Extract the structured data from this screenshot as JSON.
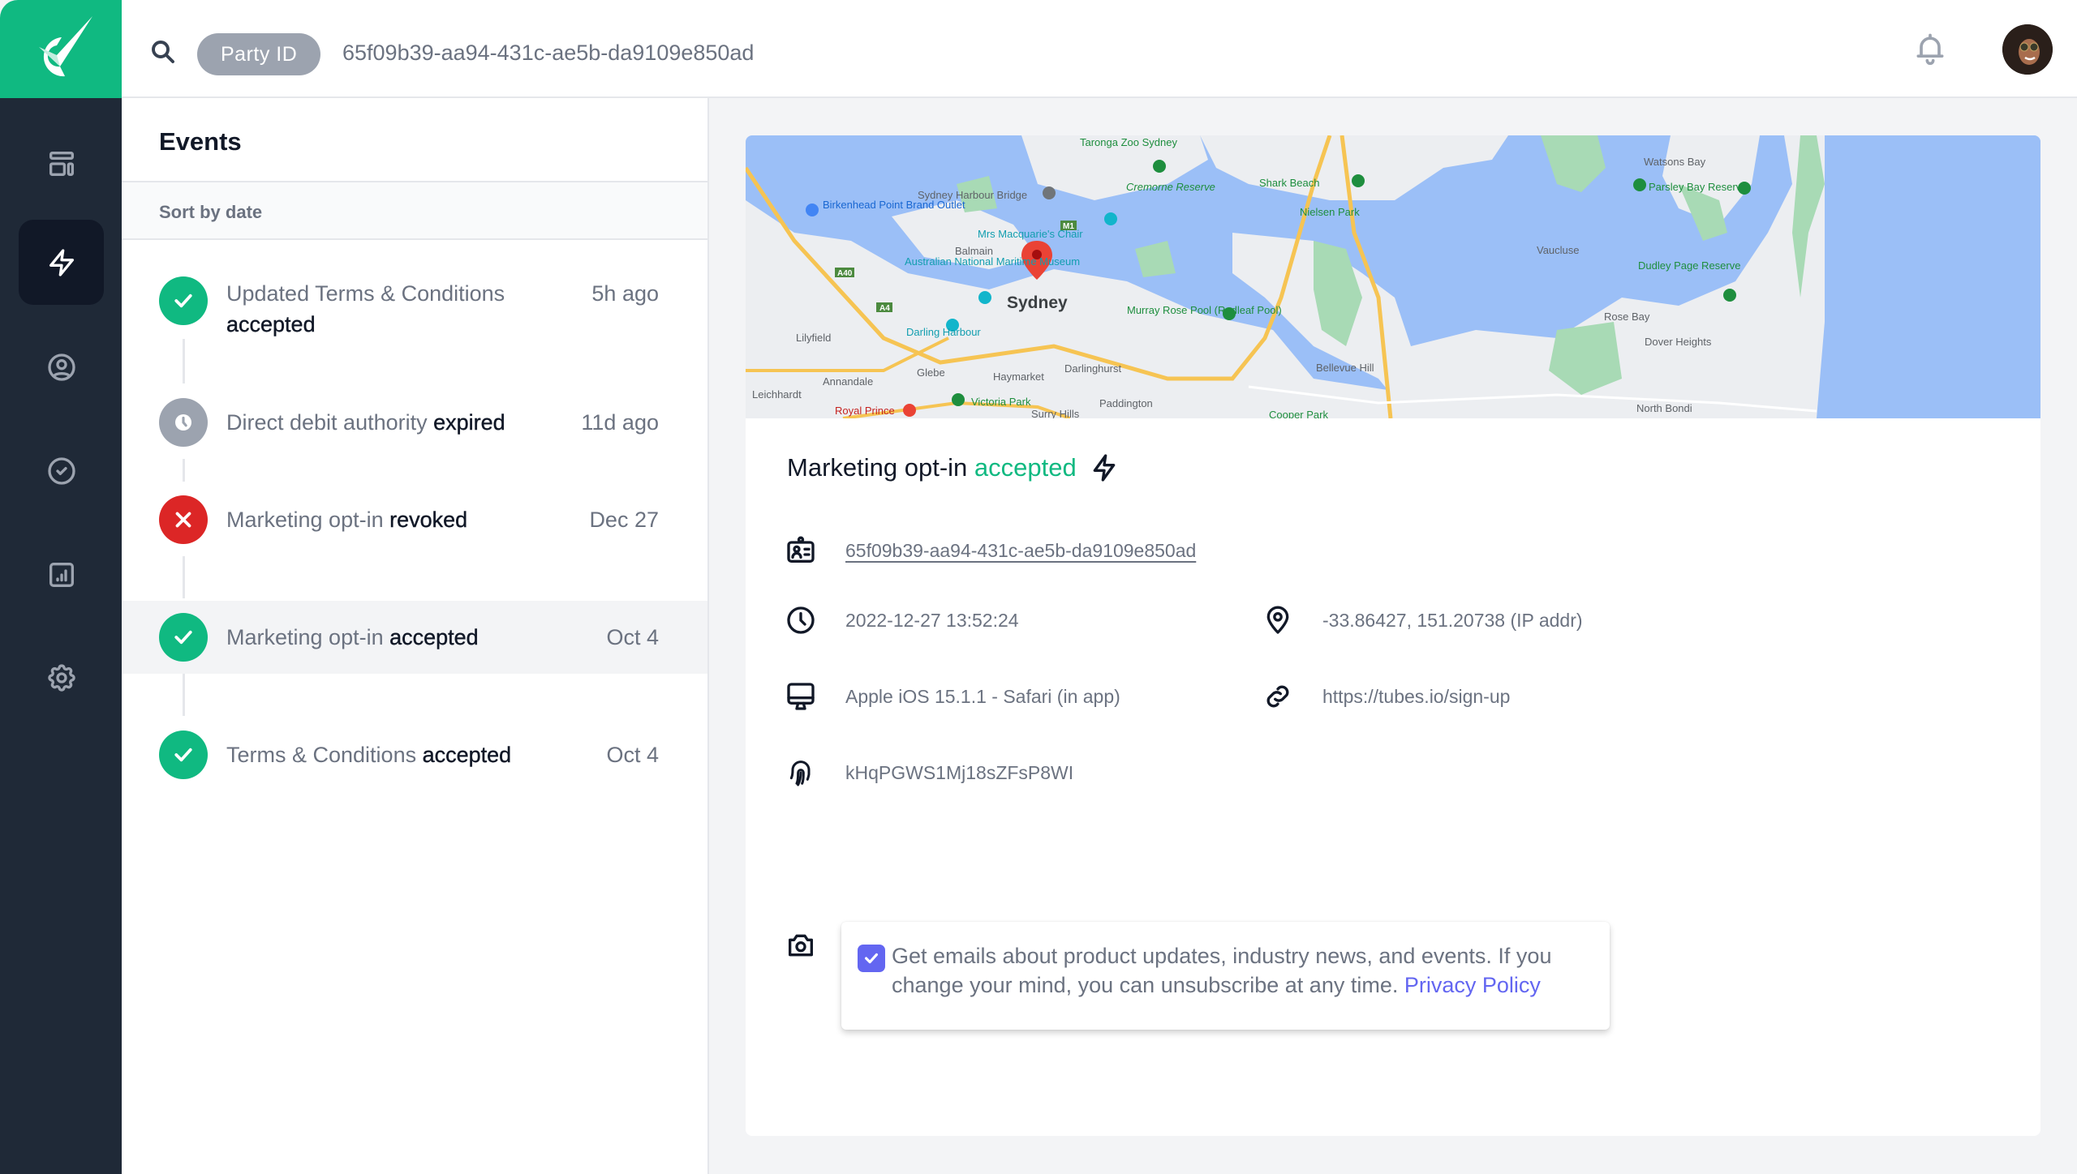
{
  "header": {
    "search_filter_label": "Party ID",
    "search_value": "65f09b39-aa94-431c-ae5b-da9109e850ad"
  },
  "sidebar": {
    "items": [
      {
        "name": "dashboard",
        "icon": "layout-icon",
        "active": false
      },
      {
        "name": "events",
        "icon": "lightning-icon",
        "active": true
      },
      {
        "name": "profile",
        "icon": "user-circle-icon",
        "active": false
      },
      {
        "name": "consents",
        "icon": "check-circle-icon",
        "active": false
      },
      {
        "name": "reports",
        "icon": "chart-icon",
        "active": false
      },
      {
        "name": "settings",
        "icon": "gear-icon",
        "active": false
      }
    ]
  },
  "events": {
    "title": "Events",
    "sort_label": "Sort by date",
    "items": [
      {
        "prefix": "Updated Terms & Conditions",
        "status": "accepted",
        "time": "5h ago",
        "type": "success",
        "icon": "check-icon"
      },
      {
        "prefix": "Direct debit authority",
        "status": "expired",
        "time": "11d ago",
        "type": "expired",
        "icon": "clock-icon"
      },
      {
        "prefix": "Marketing opt-in",
        "status": "revoked",
        "time": "Dec 27",
        "type": "error",
        "icon": "x-icon"
      },
      {
        "prefix": "Marketing opt-in",
        "status": "accepted",
        "time": "Oct 4",
        "type": "success",
        "icon": "check-icon",
        "selected": true
      },
      {
        "prefix": "Terms & Conditions",
        "status": "accepted",
        "time": "Oct 4",
        "type": "success",
        "icon": "check-icon"
      }
    ]
  },
  "detail": {
    "title_prefix": "Marketing opt-in",
    "title_status": "accepted",
    "party_id": "65f09b39-aa94-431c-ae5b-da9109e850ad",
    "timestamp": "2022-12-27 13:52:24",
    "location": "-33.86427, 151.20738 (IP addr)",
    "device": "Apple iOS 15.1.1 - Safari (in app)",
    "url": "https://tubes.io/sign-up",
    "fingerprint": "kHqPGWS1Mj18sZFsP8WI",
    "consent": {
      "checked": true,
      "text": "Get emails about product updates, industry news, and events. If you change your mind, you can unsubscribe at any time.",
      "link_label": "Privacy Policy"
    }
  },
  "map": {
    "labels": {
      "taronga": "Taronga Zoo Sydney",
      "harbour_bridge": "Sydney Harbour Bridge",
      "birkenhead": "Birkenhead Point Brand Outlet",
      "balmain": "Balmain",
      "macquarie": "Mrs Macquarie's Chair",
      "maritime": "Australian National Maritime Museum",
      "sydney": "Sydney",
      "darling": "Darling Harbour",
      "lilyfield": "Lilyfield",
      "glebe": "Glebe",
      "annandale": "Annandale",
      "leichhardt": "Leichhardt",
      "haymarket": "Haymarket",
      "darlinghurst": "Darlinghurst",
      "victoria": "Victoria Park",
      "paddington": "Paddington",
      "surry": "Surry Hills",
      "royal_prince": "Royal Prince",
      "cremorne": "Cremorne Reserve",
      "murray": "Murray Rose Pool (Redleaf Pool)",
      "bellevue": "Bellevue Hill",
      "shark": "Shark Beach",
      "nielsen": "Nielsen Park",
      "watsons": "Watsons Bay",
      "parsley": "Parsley Bay Reserve",
      "vaucluse": "Vaucluse",
      "dudley": "Dudley Page Reserve",
      "rose_bay": "Rose Bay",
      "dover": "Dover Heights",
      "north_bondi": "North Bondi",
      "cooper": "Cooper Park",
      "a40": "A40",
      "a4": "A4",
      "m1": "M1"
    },
    "colors": {
      "water": "#9bbff7",
      "land": "#eceef1",
      "park": "#a8dab5",
      "road": "#f6c453",
      "pin": "#ea4335"
    }
  },
  "colors": {
    "brand": "#10b981",
    "sidebar": "#1f2937",
    "error": "#dc2626",
    "muted": "#9ca3af",
    "accent": "#6366f1"
  }
}
